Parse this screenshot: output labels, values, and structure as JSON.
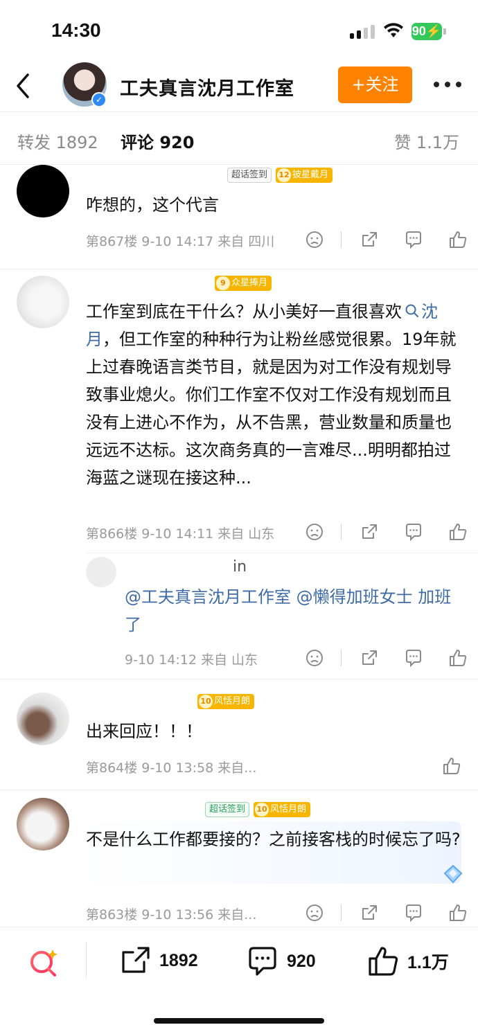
{
  "status_bar": {
    "time": "14:30",
    "battery": "90"
  },
  "header": {
    "title": "工夫真言沈月工作室",
    "follow_label": "+关注"
  },
  "tabs": {
    "repost": "转发 1892",
    "comment": "评论 920",
    "like": "赞 1.1万"
  },
  "comments": [
    {
      "badges": [
        "超话签到",
        "披星戴月"
      ],
      "badge_levels": [
        "",
        "12"
      ],
      "text": "咋想的，这个代言",
      "meta": "第867楼 9-10 14:17 来自 四川"
    },
    {
      "badges": [
        "众星捧月"
      ],
      "badge_levels": [
        "9"
      ],
      "text_before": "工作室到底在干什么？从小美好一直很喜欢",
      "topic": "沈月",
      "text_after": "，但工作室的种种行为让粉丝感觉很累。19年就上过春晚语言类节目，就是因为对工作没有规划导致事业熄火。你们工作室不仅对工作没有规划而且没有上进心不作为，从不告黑，营业数量和质量也远远不达标。这次商务真的一言难尽...明明都拍过海蓝之谜现在接这种...",
      "meta": "第866楼 9-10 14:11 来自 山东",
      "reply": {
        "name_fragment": "in",
        "text": "@工夫真言沈月工作室 @懒得加班女士 加班了",
        "meta": "9-10 14:12 来自 山东"
      }
    },
    {
      "badges": [
        "风恬月朗"
      ],
      "badge_levels": [
        "10"
      ],
      "text": "出来回应！！！",
      "meta": "第864楼 9-10 13:58 来自..."
    },
    {
      "badges": [
        "超话签到",
        "风恬月朗"
      ],
      "badge_levels": [
        "",
        "10"
      ],
      "text": "不是什么工作都要接的？之前接客栈的时候忘了吗?",
      "meta": "第863楼 9-10 13:56 来自..."
    }
  ],
  "bottom_bar": {
    "repost_count": "1892",
    "comment_count": "920",
    "like_count": "1.1万"
  },
  "colors": {
    "accent_orange": "#ff8200",
    "link_blue": "#3e6ba8",
    "badge_gold": "#f7b500",
    "battery_green": "#34c759"
  }
}
